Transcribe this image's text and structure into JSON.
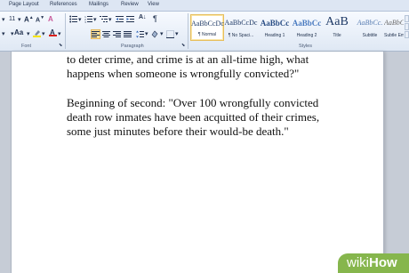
{
  "ribbon": {
    "tabs": [
      "Page Layout",
      "References",
      "Mailings",
      "Review",
      "View"
    ],
    "font_size": "11",
    "groups": {
      "font": "Font",
      "paragraph": "Paragraph",
      "styles": "Styles"
    },
    "styles": [
      {
        "preview": "AaBbCcDc",
        "name": "¶ Normal",
        "active": true
      },
      {
        "preview": "AaBbCcDc",
        "name": "¶ No Spaci..."
      },
      {
        "preview": "AaBbCc",
        "name": "Heading 1"
      },
      {
        "preview": "AaBbCc",
        "name": "Heading 2"
      },
      {
        "preview": "AaB",
        "name": "Title"
      },
      {
        "preview": "AaBbCc.",
        "name": "Subtitle"
      },
      {
        "preview": "AaBbCcL",
        "name": "Subtle Em"
      }
    ],
    "colors": {
      "highlight": "#f5e400",
      "font_color": "#d9201c"
    }
  },
  "document": {
    "paragraphs": [
      "to deter crime, and crime is at an all-time high, what happens when someone is wrongfully convicted?\"",
      "Beginning of second: \"Over 100 wrongfully convicted death row inmates have been acquitted of their crimes, some just minutes before their would-be death.\""
    ]
  },
  "watermark": {
    "part1": "wiki",
    "part2": "How"
  }
}
